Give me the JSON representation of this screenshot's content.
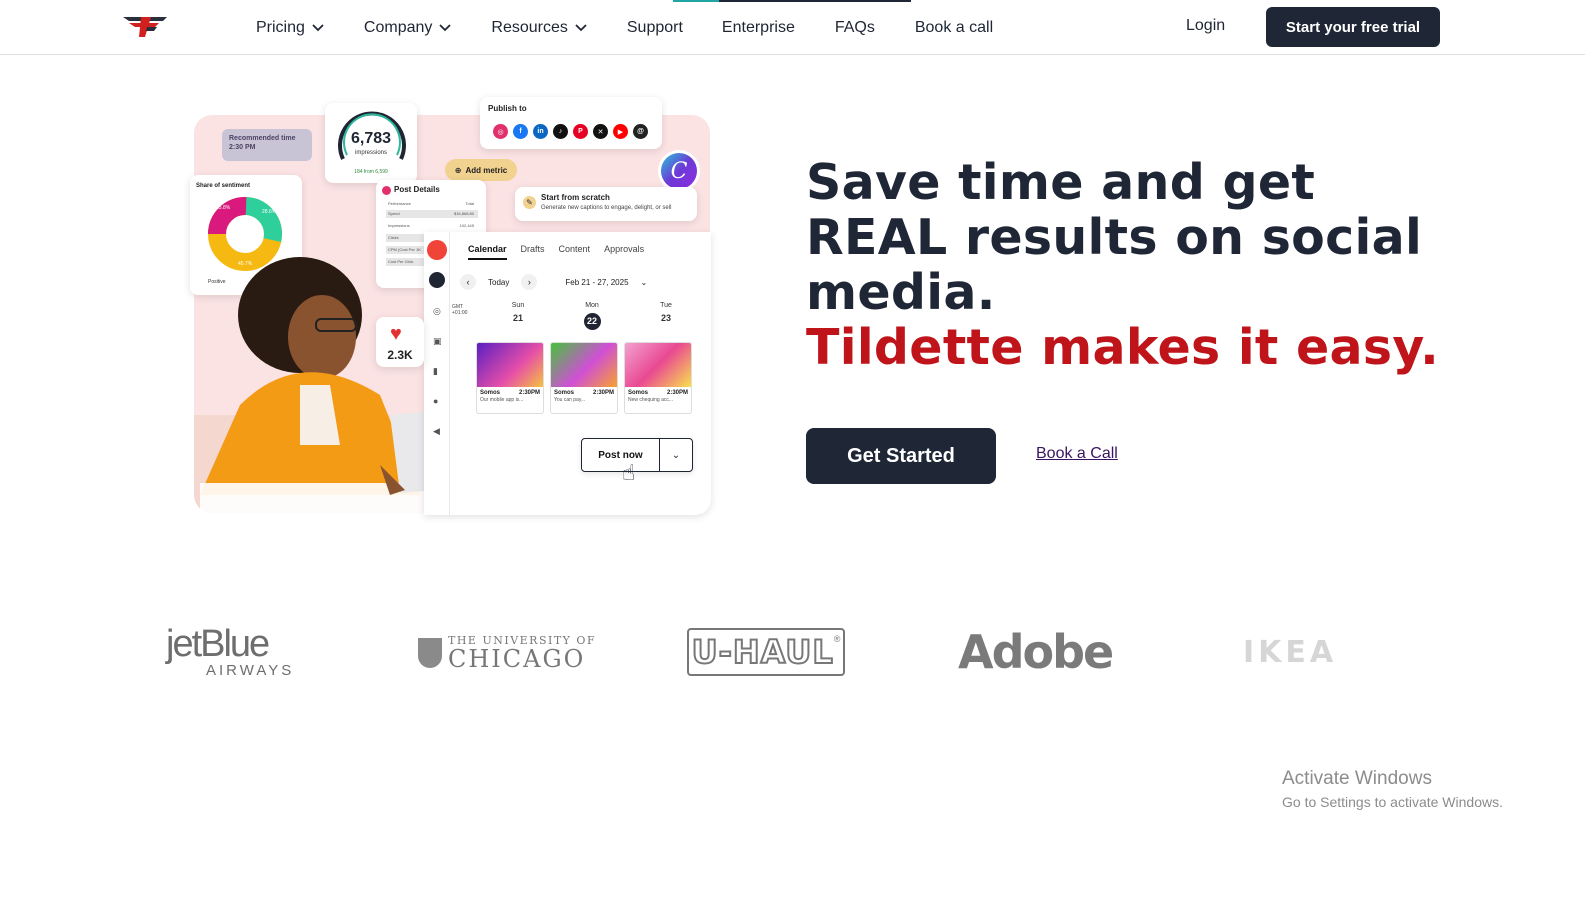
{
  "header": {
    "nav": [
      {
        "label": "Pricing",
        "dropdown": true
      },
      {
        "label": "Company",
        "dropdown": true
      },
      {
        "label": "Resources",
        "dropdown": true
      },
      {
        "label": "Support",
        "dropdown": false
      },
      {
        "label": "Enterprise",
        "dropdown": false
      },
      {
        "label": "FAQs",
        "dropdown": false
      },
      {
        "label": "Book a call",
        "dropdown": false
      }
    ],
    "login_label": "Login",
    "trial_label": "Start your free trial"
  },
  "hero": {
    "headline": "Save time and get REAL results on social media.",
    "headline_accent": "Tildette makes it easy.",
    "cta_primary": "Get Started",
    "cta_secondary": "Book a Call"
  },
  "illustration": {
    "recommended_time_label": "Recommended time",
    "recommended_time_value": "2:30 PM",
    "impressions_value": "6,783",
    "impressions_label": "impressions",
    "impressions_sub": "184 from 6,599",
    "publish_label": "Publish to",
    "social_icons": [
      "instagram-icon",
      "facebook-icon",
      "linkedin-icon",
      "tiktok-icon",
      "pinterest-icon",
      "x-icon",
      "youtube-icon",
      "threads-icon"
    ],
    "add_metric_label": "Add metric",
    "scratch_title": "Start from scratch",
    "scratch_sub": "Generate new captions to engage, delight, or sell",
    "sentiment_label": "Share of sentiment",
    "sentiment_values": [
      "25.8%",
      "28.6%",
      "45.7%"
    ],
    "sentiment_legend": [
      "Positive"
    ],
    "post_details_label": "Post Details",
    "post_details_rows": [
      {
        "label": "Performance",
        "value": "Total"
      },
      {
        "label": "Spend",
        "value": "$16,868.80"
      },
      {
        "label": "Impressions",
        "value": "102,445"
      },
      {
        "label": "Clicks",
        "value": ""
      },
      {
        "label": "CPM (Cost Per 1K",
        "value": ""
      },
      {
        "label": "Cost Per Click",
        "value": ""
      }
    ],
    "calendar_tabs": [
      "Calendar",
      "Drafts",
      "Content",
      "Approvals"
    ],
    "today_label": "Today",
    "date_range": "Feb 21 - 27, 2025",
    "timezone": "GMT +01:00",
    "days": [
      {
        "name": "Sun",
        "num": "21",
        "selected": false
      },
      {
        "name": "Mon",
        "num": "22",
        "selected": true
      },
      {
        "name": "Tue",
        "num": "23",
        "selected": false
      }
    ],
    "posts": [
      {
        "account": "Somos",
        "time": "2:30PM",
        "desc": "Our mobile app is...",
        "color": "#7b2bd1"
      },
      {
        "account": "Somos",
        "time": "2:30PM",
        "desc": "You can pay...",
        "color": "#58c73f"
      },
      {
        "account": "Somos",
        "time": "2:30PM",
        "desc": "New chequing acc...",
        "color": "#ec3f8e"
      }
    ],
    "likes_value": "2.3K",
    "post_now_label": "Post now"
  },
  "logos": [
    {
      "name": "jetblue-logo",
      "line1": "jetBlue",
      "line2": "AIRWAYS"
    },
    {
      "name": "uchicago-logo",
      "line1": "THE UNIVERSITY OF",
      "line2": "CHICAGO"
    },
    {
      "name": "uhaul-logo",
      "line1": "U-HAUL",
      "line2": "®"
    },
    {
      "name": "adobe-logo",
      "line1": "Adobe",
      "line2": ""
    },
    {
      "name": "ikea-logo",
      "line1": "IKEA",
      "line2": ""
    }
  ],
  "watermark": {
    "title": "Activate Windows",
    "subtitle": "Go to Settings to activate Windows."
  },
  "colors": {
    "primary_dark": "#1f2635",
    "accent_red": "#c0141b",
    "link_purple": "#3a1560",
    "top_accent": "#1fa5a5"
  }
}
